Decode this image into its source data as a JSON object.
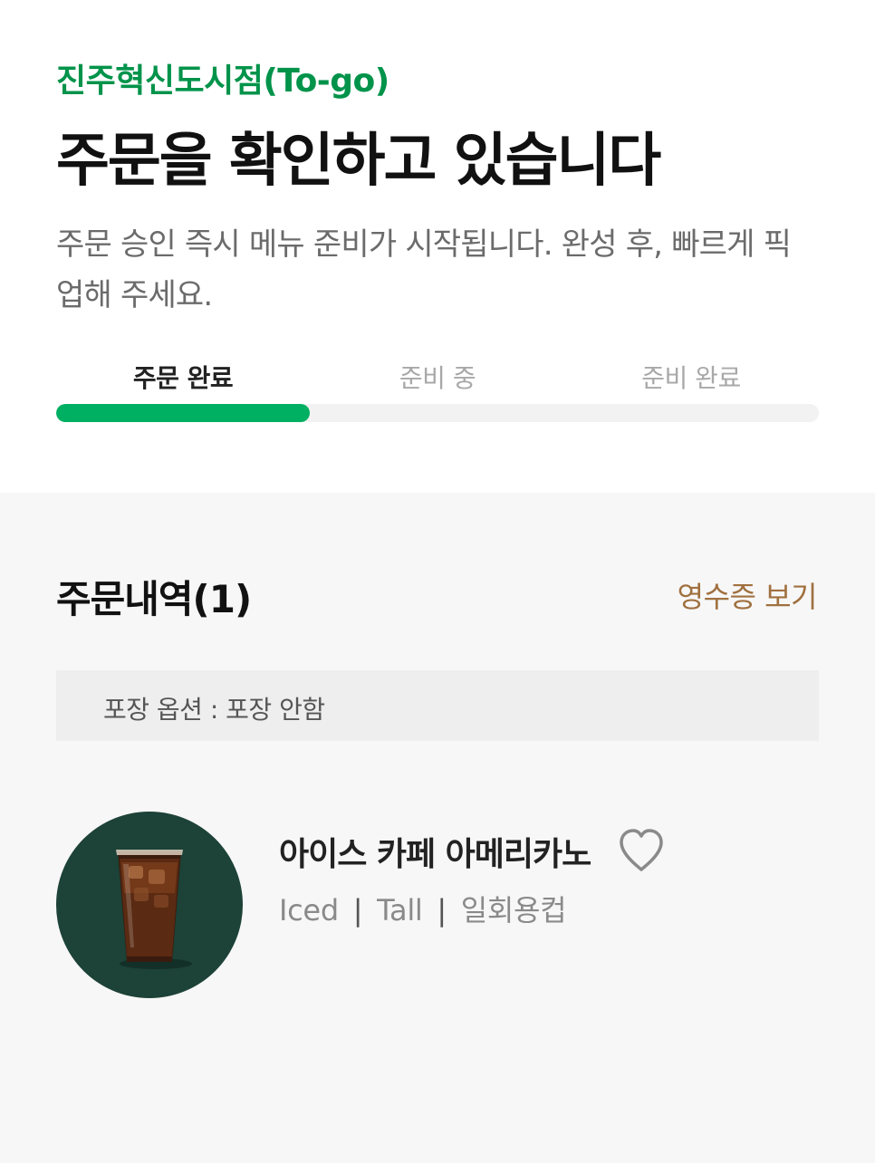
{
  "header": {
    "store_name": "진주혁신도시점(To-go)",
    "headline": "주문을 확인하고 있습니다",
    "description": "주문 승인 즉시 메뉴 준비가 시작됩니다. 완성 후, 빠르게 픽업해 주세요."
  },
  "progress": {
    "steps": [
      "주문 완료",
      "준비 중",
      "준비 완료"
    ],
    "current_step": 1,
    "fraction": 0.333,
    "accent_color": "#00b062"
  },
  "order": {
    "title": "주문내역(1)",
    "receipt_label": "영수증 보기",
    "packaging_text": "포장 옵션 : 포장 안함",
    "items": [
      {
        "name": "아이스 카페 아메리카노",
        "options": [
          "Iced",
          "Tall",
          "일회용컵"
        ],
        "separator": "|",
        "image_icon": "iced-americano-cup",
        "favorite_icon": "heart-outline-icon"
      }
    ]
  },
  "colors": {
    "store_name": "#00934a",
    "receipt_link": "#a0703f",
    "thumb_bg": "#1d4237"
  }
}
